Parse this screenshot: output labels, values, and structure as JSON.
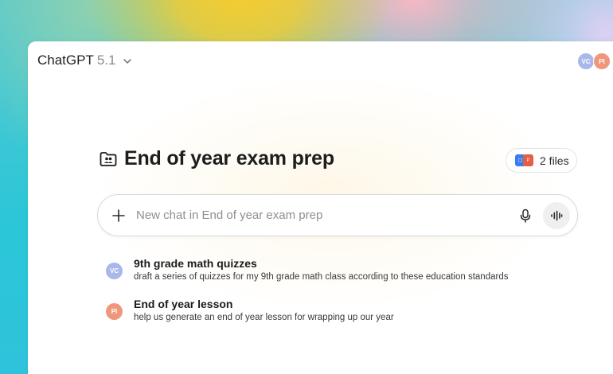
{
  "app": {
    "name": "ChatGPT",
    "version": "5.1"
  },
  "participants": [
    {
      "initials": "VC",
      "color": "#a9b8ea"
    },
    {
      "initials": "PI",
      "color": "#f0967a"
    }
  ],
  "project": {
    "title": "End of year exam prep",
    "files_label": "2 files"
  },
  "composer": {
    "placeholder": "New chat in End of year exam prep"
  },
  "chats": [
    {
      "avatar": "VC",
      "avatar_color": "#a9b8ea",
      "title": "9th grade math quizzes",
      "subtitle": "draft a series of quizzes for my 9th grade math class according to these education standards"
    },
    {
      "avatar": "PI",
      "avatar_color": "#f0967a",
      "title": "End of year lesson",
      "subtitle": "help us generate an end of year lesson for wrapping up our year"
    }
  ],
  "icons": {
    "model_dropdown": "chevron-down-icon",
    "project": "folder-people-icon",
    "add": "plus-icon",
    "mic": "microphone-icon",
    "voice": "voice-waveform-icon"
  }
}
